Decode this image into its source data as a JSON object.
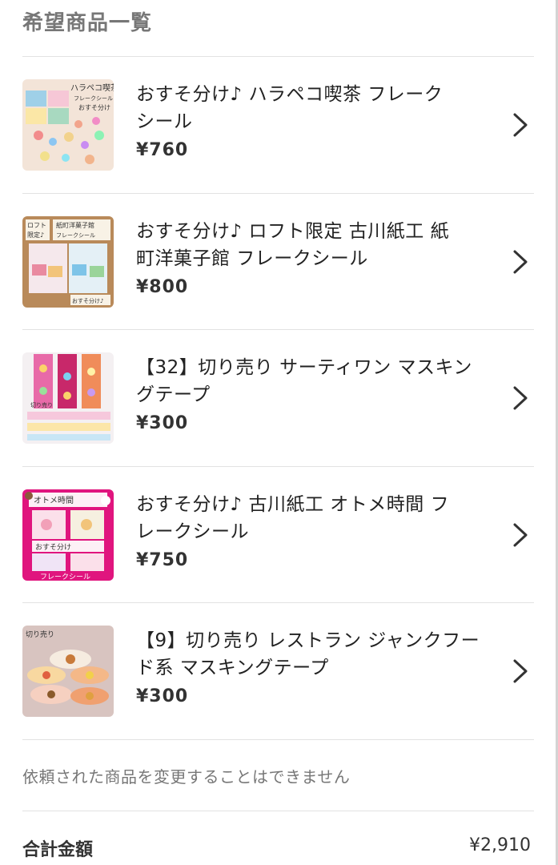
{
  "section_title": "希望商品一覧",
  "items": [
    {
      "name_line1": "おすそ分け♪ ハラペコ喫茶 フレーク",
      "name_line2": "シール",
      "price": "¥760",
      "thumb_text": [
        "ハラペコ喫茶",
        "フレークシール",
        "おすそ分け"
      ],
      "thumb_bg": "#f3e4d8"
    },
    {
      "name_line1": "おすそ分け♪ ロフト限定 古川紙工 紙",
      "name_line2": "町洋菓子館 フレークシール",
      "price": "¥800",
      "thumb_text": [
        "ロフト",
        "限定♪",
        "紙町洋菓子館",
        "フレークシール",
        "おすそ分け♪"
      ],
      "thumb_bg": "#b98a5a"
    },
    {
      "name_line1": "【32】切り売り サーティワン マスキン",
      "name_line2": "グテープ",
      "price": "¥300",
      "thumb_text": [
        "切り売り"
      ],
      "thumb_bg": "#f4f0f2"
    },
    {
      "name_line1": "おすそ分け♪ 古川紙工 オトメ時間 フ",
      "name_line2": "レークシール",
      "price": "¥750",
      "thumb_text": [
        "オトメ時間",
        "おすそ分け",
        "フレークシール"
      ],
      "thumb_bg": "#e0157e"
    },
    {
      "name_line1": "【9】切り売り レストラン ジャンクフー",
      "name_line2": "ド系 マスキングテープ",
      "price": "¥300",
      "thumb_text": [
        "切り売り"
      ],
      "thumb_bg": "#d8c4c0"
    }
  ],
  "notice": "依頼された商品を変更することはできません",
  "total": {
    "label": "合計金額",
    "value": "¥2,910"
  },
  "colors": {
    "title_gray": "#777777",
    "divider": "#e2e2e2",
    "text": "#222222"
  }
}
